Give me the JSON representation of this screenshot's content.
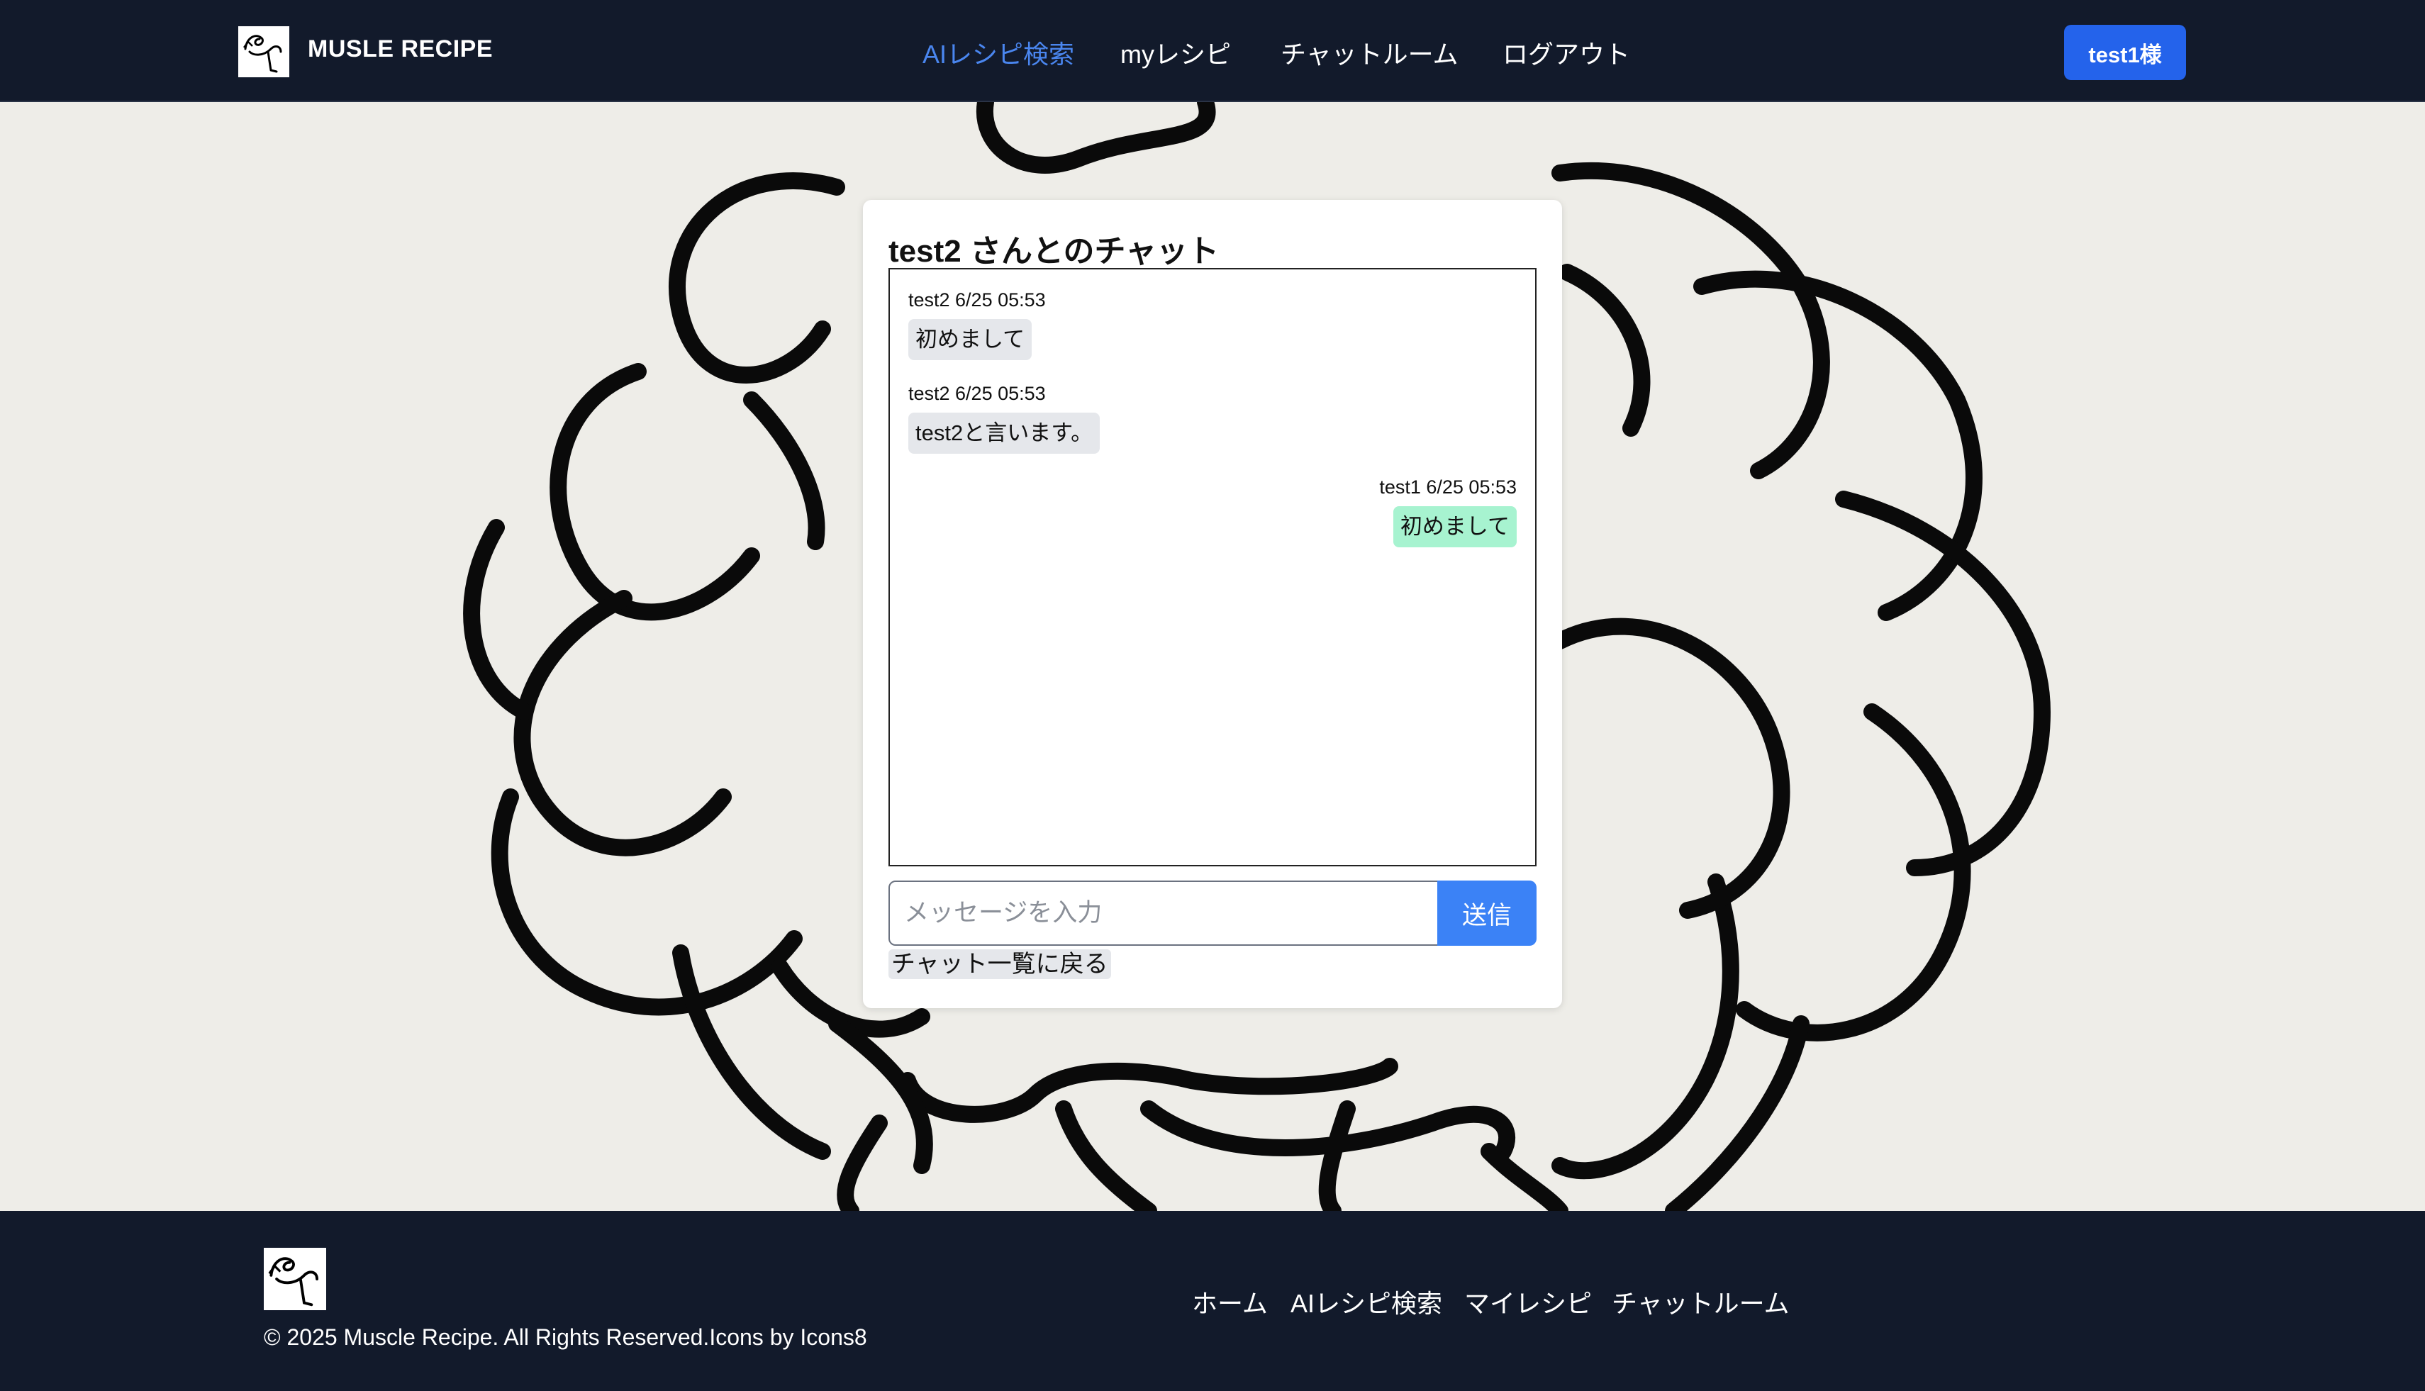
{
  "header": {
    "brand": "MUSLE RECIPE",
    "nav": [
      "AIレシピ検索",
      "myレシピ",
      "チャットルーム",
      "ログアウト"
    ],
    "active_nav": "AIレシピ検索",
    "user_button": "test1様",
    "logo_icon": "muscle-arm-icon"
  },
  "chat": {
    "title": "test2 さんとのチャット",
    "messages": [
      {
        "meta": "test2 6/25 05:53",
        "text": "初めまして",
        "side": "left"
      },
      {
        "meta": "test2 6/25 05:53",
        "text": "test2と言います。",
        "side": "left"
      },
      {
        "meta": "test1 6/25 05:53",
        "text": "初めまして",
        "side": "right"
      }
    ],
    "input_placeholder": "メッセージを入力",
    "send_label": "送信",
    "back_label": "チャット一覧に戻る"
  },
  "footer": {
    "copyright": "© 2025 Muscle Recipe. All Rights Reserved.Icons by Icons8",
    "links": [
      "ホーム",
      "AIレシピ検索",
      "マイレシピ",
      "チャットルーム"
    ]
  },
  "colors": {
    "header_bg": "#121a2b",
    "accent": "#2463eb",
    "active_nav": "#4a86ef",
    "bubble_in": "#e5e7eb",
    "bubble_out": "#a7f3d0"
  }
}
